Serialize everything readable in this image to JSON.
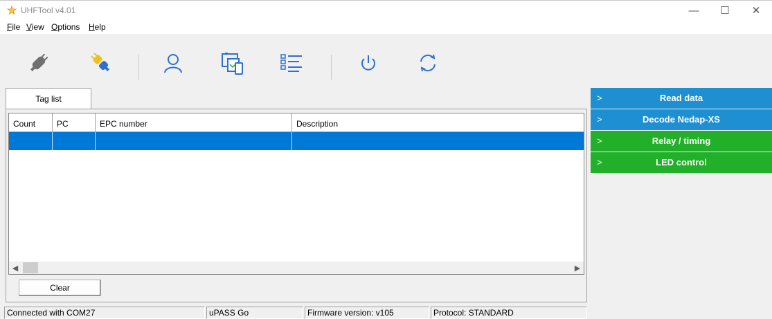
{
  "window": {
    "title": "UHFTool v4.01",
    "minimize": "—",
    "maximize": "☐",
    "close": "✕"
  },
  "menu": [
    {
      "mnemonic": "F",
      "rest": "ile"
    },
    {
      "mnemonic": "V",
      "rest": "iew"
    },
    {
      "mnemonic": "O",
      "rest": "ptions"
    },
    {
      "mnemonic": "H",
      "rest": "elp"
    }
  ],
  "toolbar": {
    "icons": [
      "disconnect-plug-icon",
      "connect-plug-icon",
      "user-icon",
      "devices-icon",
      "list-icon",
      "power-icon",
      "refresh-icon"
    ]
  },
  "tabs": [
    {
      "label": "Tag list"
    }
  ],
  "table": {
    "columns": [
      "Count",
      "PC",
      "EPC number",
      "Description"
    ],
    "selected_row": [
      "",
      "",
      "",
      ""
    ]
  },
  "buttons": {
    "clear": "Clear"
  },
  "side_panel": [
    {
      "chevron": ">",
      "label": "Read data",
      "color": "#1e90d2"
    },
    {
      "chevron": ">",
      "label": "Decode Nedap-XS",
      "color": "#1e90d2"
    },
    {
      "chevron": ">",
      "label": "Relay / timing",
      "color": "#22b02a"
    },
    {
      "chevron": ">",
      "label": "LED control",
      "color": "#22b02a"
    }
  ],
  "status": {
    "connection": "Connected with COM27",
    "device": "uPASS Go",
    "firmware": "Firmware version: v105",
    "protocol": "Protocol: STANDARD"
  },
  "colors": {
    "selection": "#0078d7",
    "app_icon": "#f0a020"
  }
}
